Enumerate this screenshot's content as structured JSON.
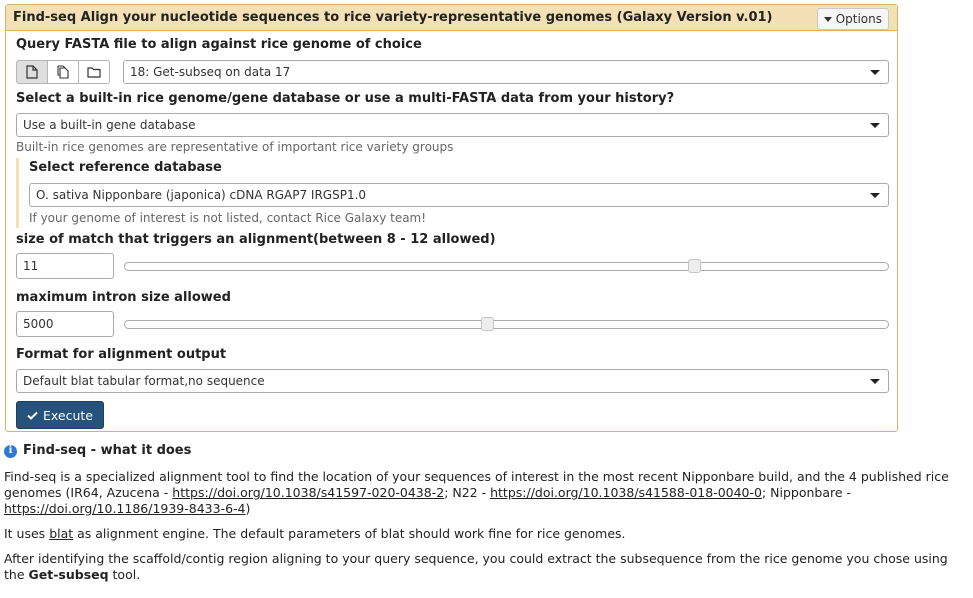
{
  "tool": {
    "title": "Find-seq Align your nucleotide sequences to rice variety-representative genomes (Galaxy Version v.01)",
    "options_label": "Options"
  },
  "query": {
    "label": "Query FASTA file to align against rice genome of choice",
    "selected": "18: Get-subseq on data 17"
  },
  "db_source": {
    "label": "Select a built-in rice genome/gene database or use a multi-FASTA data from your history?",
    "selected": "Use a built-in gene database",
    "help": "Built-in rice genomes are representative of important rice variety groups"
  },
  "reference": {
    "label": "Select reference database",
    "selected": "O. sativa Nipponbare (japonica) cDNA RGAP7 IRGSP1.0",
    "help": "If your genome of interest is not listed, contact Rice Galaxy team!"
  },
  "match_size": {
    "label": "size of match that triggers an alignment(between 8 - 12 allowed)",
    "value": "11",
    "slider_fraction": 0.75
  },
  "intron": {
    "label": "maximum intron size allowed",
    "value": "5000",
    "slider_fraction": 0.475
  },
  "format": {
    "label": "Format for alignment output",
    "selected": "Default blat tabular format,no sequence"
  },
  "execute_label": "Execute",
  "help": {
    "title": "Find-seq - what it does",
    "p1_text": "Find-seq is a specialized alignment tool to find the location of your sequences of interest in the most recent Nipponbare build, and the 4 published rice genomes (IR64, Azucena - ",
    "p1_link1": "https://doi.org/10.1038/s41597-020-0438-2",
    "p1_mid": "; N22 - ",
    "p1_link2": "https://doi.org/10.1038/s41588-018-0040-0",
    "p1_mid2": "; Nipponbare - ",
    "p1_link3": "https://doi.org/10.1186/1939-8433-6-4",
    "p1_end": ")",
    "p2_pre": "It uses ",
    "p2_link": "blat",
    "p2_post": " as alignment engine. The default parameters of blat should work fine for rice genomes.",
    "p3_pre": "After identifying the scaffold/contig region aligning to your query sequence, you could extract the subsequence from the rice genome you chose using the ",
    "p3_bold": "Get-subseq",
    "p3_post": " tool."
  }
}
